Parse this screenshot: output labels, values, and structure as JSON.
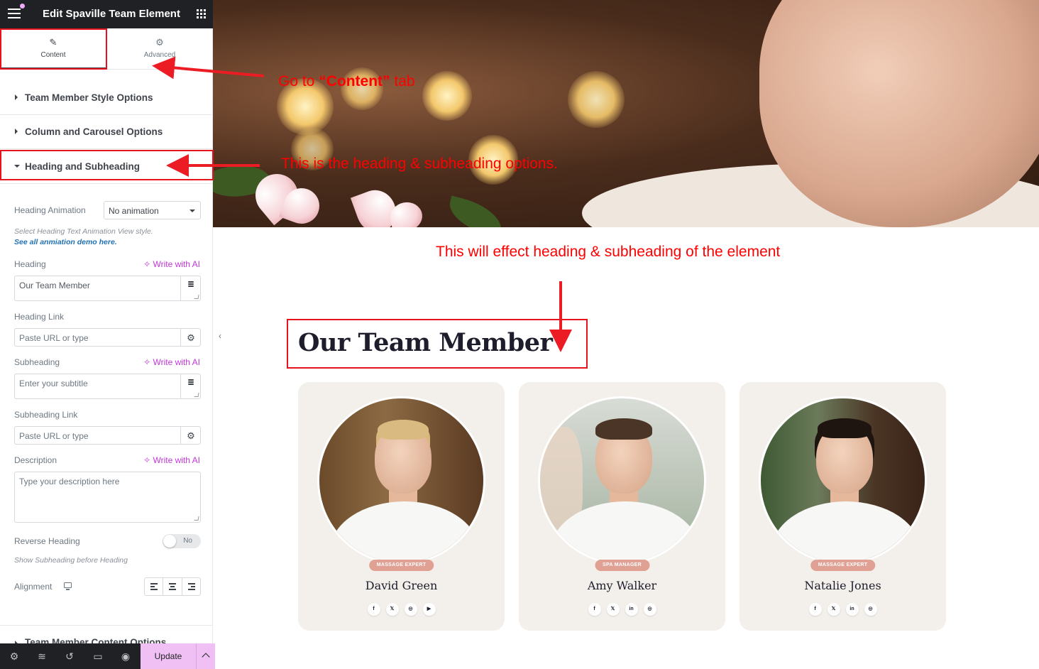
{
  "editor": {
    "title": "Edit Spaville Team Element",
    "tabs": {
      "content": "Content",
      "advanced": "Advanced"
    },
    "sections": {
      "team_style": "Team Member Style Options",
      "column_carousel": "Column and Carousel Options",
      "heading_subheading": "Heading and Subheading",
      "team_content": "Team Member Content Options"
    },
    "controls": {
      "heading_animation_label": "Heading Animation",
      "heading_animation_value": "No animation",
      "heading_animation_hint": "Select Heading Text Animation View style.",
      "heading_animation_link": "See all anmiation demo here.",
      "heading_label": "Heading",
      "heading_value": "Our Team Member",
      "write_with_ai": "Write with AI",
      "heading_link_label": "Heading Link",
      "url_placeholder": "Paste URL or type",
      "subheading_label": "Subheading",
      "subheading_placeholder": "Enter your subtitle",
      "subheading_link_label": "Subheading Link",
      "description_label": "Description",
      "description_placeholder": "Type your description here",
      "reverse_heading_label": "Reverse Heading",
      "reverse_heading_value": "No",
      "reverse_heading_hint": "Show Subheading before Heading",
      "alignment_label": "Alignment"
    },
    "footer": {
      "update": "Update"
    }
  },
  "annotations": {
    "go_prefix": "Go  to ",
    "go_bold": "“Content”",
    "go_suffix": " tab",
    "heading_options": "This is the heading & subheading options.",
    "effect": "This will effect heading & subheading of the element"
  },
  "preview": {
    "heading": "Our Team Member",
    "members": [
      {
        "role": "MASSAGE EXPERT",
        "name": "David Green",
        "socials": [
          "f",
          "𝕏",
          "◎",
          "▶"
        ]
      },
      {
        "role": "SPA MANAGER",
        "name": "Amy Walker",
        "socials": [
          "f",
          "𝕏",
          "in",
          "◎"
        ]
      },
      {
        "role": "MASSAGE EXPERT",
        "name": "Natalie Jones",
        "socials": [
          "f",
          "𝕏",
          "in",
          "◎"
        ]
      }
    ]
  },
  "colors": {
    "annotation_red": "#ff0000",
    "topbar": "#1f2124",
    "ai_purple": "#c036d6",
    "update_button": "#f0c0f4",
    "badge": "#e0a094",
    "card_bg": "#f3f0eb"
  },
  "icons": {
    "menu": "hamburger-icon",
    "apps": "grid-icon",
    "content_tab": "pencil-icon",
    "advanced_tab": "gear-icon",
    "dynamic": "database-icon",
    "link_settings": "gear-icon",
    "responsive": "desktop-icon",
    "footer": [
      "settings-icon",
      "layers-icon",
      "history-icon",
      "responsive-icon",
      "preview-icon"
    ]
  }
}
